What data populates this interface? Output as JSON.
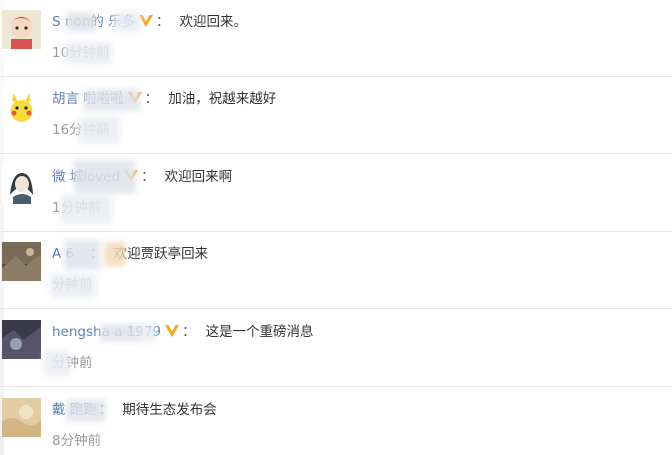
{
  "comments": [
    {
      "name": "S  non的  乐多",
      "vip": true,
      "text": "欢迎回来。",
      "time": "10分钟前"
    },
    {
      "name": "胡言   啦啦啦",
      "vip": true,
      "text": "加油，祝越来越好",
      "time": "16分钟前"
    },
    {
      "name": "微   城loved",
      "vip": true,
      "text": "欢迎回来啊",
      "time": "1分钟前"
    },
    {
      "name": "A   6",
      "vip": false,
      "text": "欢迎贾跃亭回来",
      "time": "分钟前"
    },
    {
      "name": "hengsha   a  1979",
      "vip": true,
      "text": "这是一个重磅消息",
      "time": "分钟前"
    },
    {
      "name": "戴   跑跑",
      "vip": false,
      "text": "期待生态发布会",
      "time": "8分钟前"
    }
  ],
  "colors": {
    "name": "#5a7fb8",
    "time": "#999999",
    "vip": "#f5a623",
    "divider": "#e6e6e6"
  },
  "icons": {
    "vip": "v-badge-icon"
  }
}
